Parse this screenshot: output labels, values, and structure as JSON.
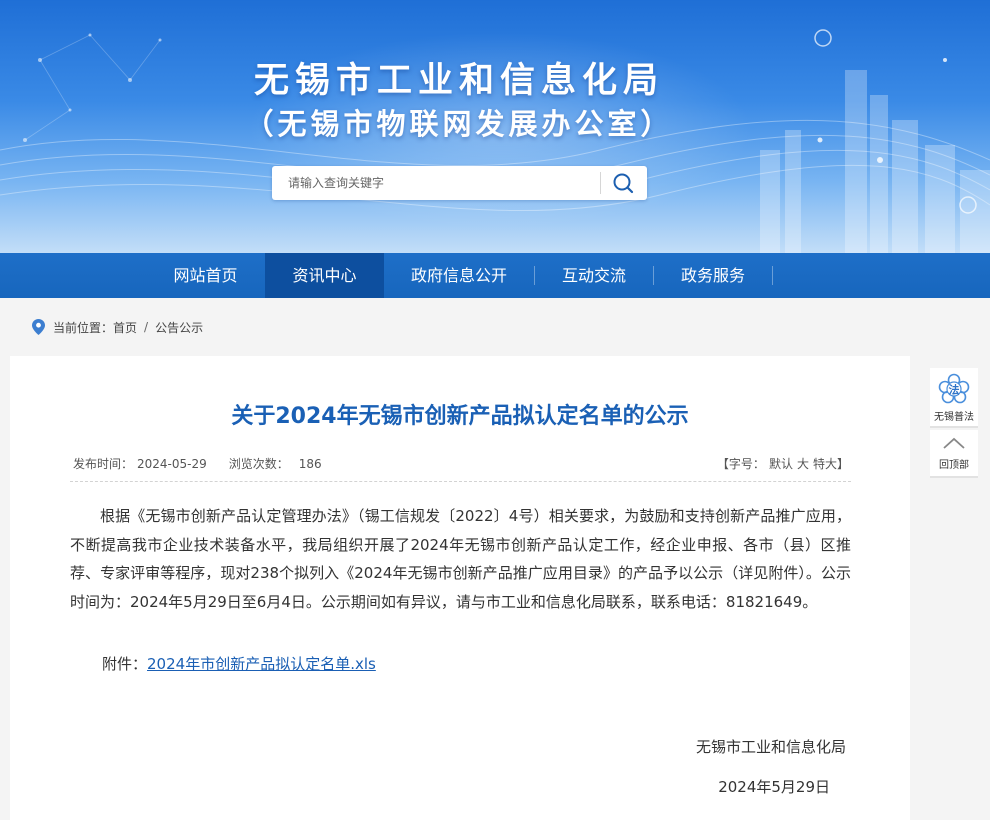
{
  "header": {
    "title": "无锡市工业和信息化局",
    "subtitle": "（无锡市物联网发展办公室）",
    "search": {
      "placeholder": "请输入查询关键字"
    }
  },
  "nav": {
    "items": [
      {
        "label": "网站首页"
      },
      {
        "label": "资讯中心",
        "active": true
      },
      {
        "label": "政府信息公开"
      },
      {
        "label": "互动交流"
      },
      {
        "label": "政务服务"
      }
    ]
  },
  "breadcrumb": {
    "prefix": "当前位置：",
    "home": "首页",
    "separator": "/",
    "current": "公告公示"
  },
  "article": {
    "title": "关于2024年无锡市创新产品拟认定名单的公示",
    "publish_label": "发布时间：",
    "publish_date": "2024-05-29",
    "views_label": "浏览次数：",
    "views": "186",
    "font_size": {
      "open": "【",
      "label": "字号：",
      "default": "默认",
      "large": "大",
      "xlarge": "特大",
      "close": "】"
    },
    "body": "根据《无锡市创新产品认定管理办法》（锡工信规发〔2022〕4号）相关要求，为鼓励和支持创新产品推广应用，不断提高我市企业技术装备水平，我局组织开展了2024年无锡市创新产品认定工作，经企业申报、各市（县）区推荐、专家评审等程序，现对238个拟列入《2024年无锡市创新产品推广应用目录》的产品予以公示（详见附件）。公示时间为：2024年5月29日至6月4日。公示期间如有异议，请与市工业和信息化局联系，联系电话：81821649。",
    "attachment_label": "附件：",
    "attachment_link": "2024年市创新产品拟认定名单.xls",
    "signature_org": "无锡市工业和信息化局",
    "signature_date": "2024年5月29日"
  },
  "sidebar_float": {
    "pufa_label": "无锡普法",
    "pufa_icon_text": "法",
    "back_top_label": "回顶部"
  },
  "colors": {
    "nav_bg": "#1766bd",
    "nav_active": "#0d4f9f",
    "title_blue": "#1a60b5",
    "link_blue": "#1a5fb4"
  }
}
